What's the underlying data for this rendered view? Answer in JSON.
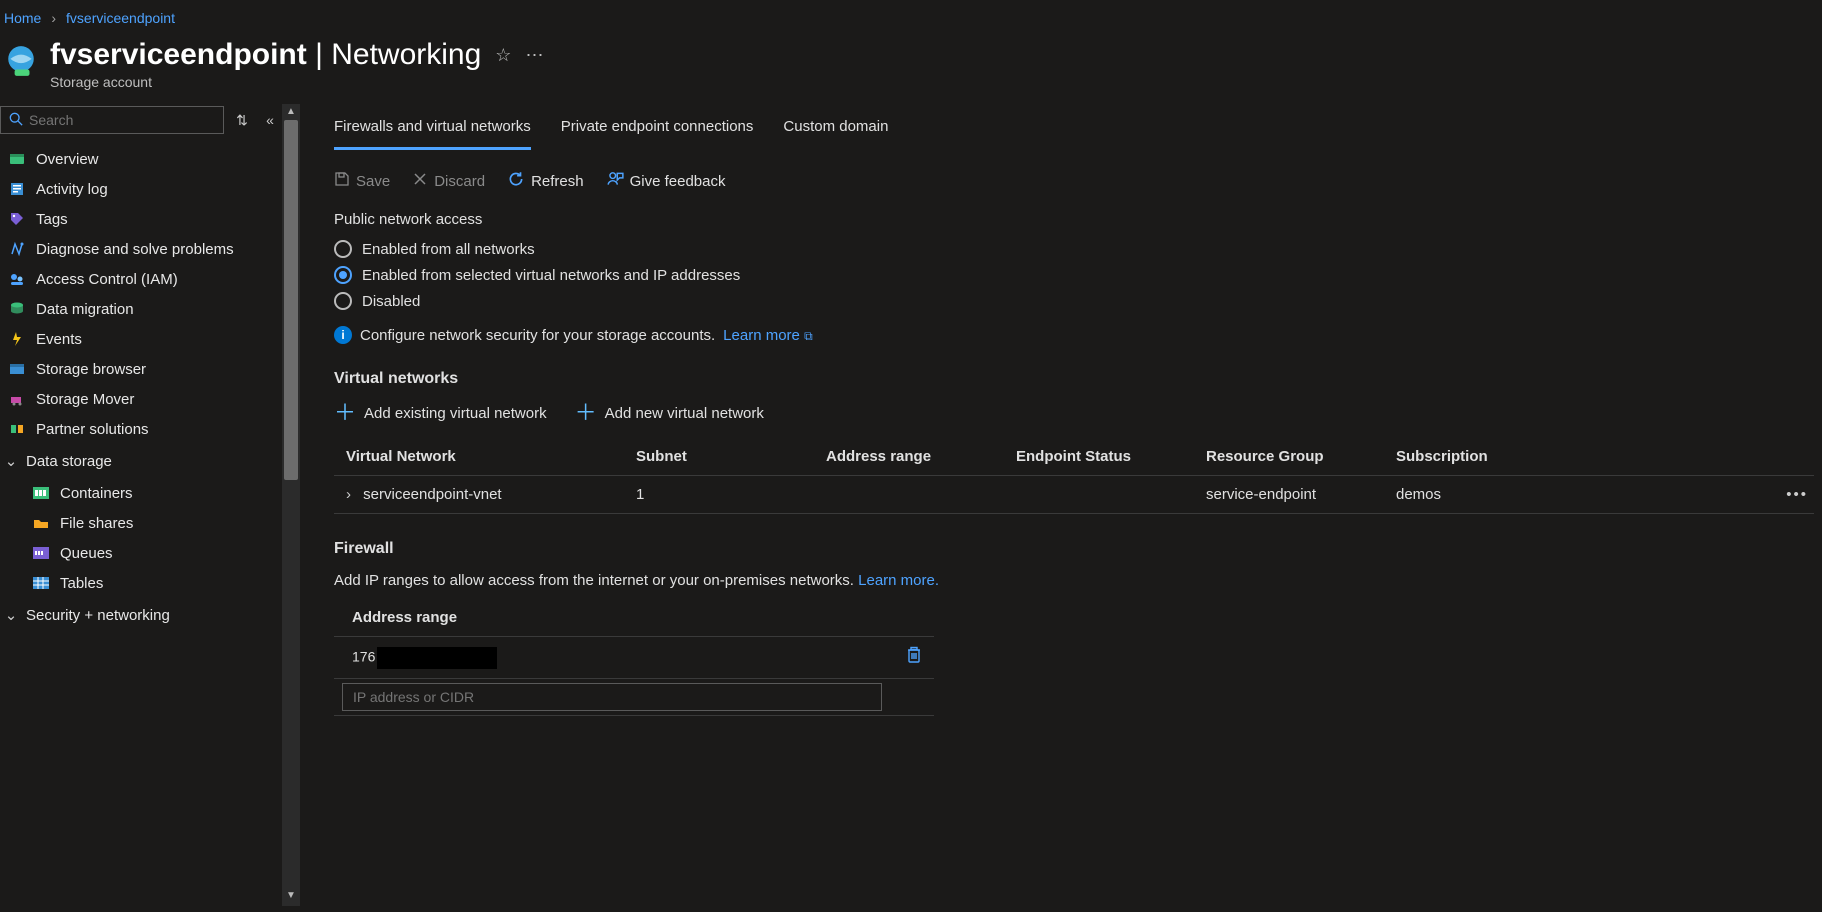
{
  "breadcrumb": {
    "home": "Home",
    "current": "fvserviceendpoint"
  },
  "header": {
    "resource": "fvserviceendpoint",
    "section": "Networking",
    "subtitle": "Storage account"
  },
  "sidebar": {
    "search_placeholder": "Search",
    "items": [
      {
        "label": "Overview"
      },
      {
        "label": "Activity log"
      },
      {
        "label": "Tags"
      },
      {
        "label": "Diagnose and solve problems"
      },
      {
        "label": "Access Control (IAM)"
      },
      {
        "label": "Data migration"
      },
      {
        "label": "Events"
      },
      {
        "label": "Storage browser"
      },
      {
        "label": "Storage Mover"
      },
      {
        "label": "Partner solutions"
      }
    ],
    "group_data_storage": "Data storage",
    "ds_items": [
      {
        "label": "Containers"
      },
      {
        "label": "File shares"
      },
      {
        "label": "Queues"
      },
      {
        "label": "Tables"
      }
    ],
    "group_security": "Security + networking"
  },
  "tabs": {
    "firewalls": "Firewalls and virtual networks",
    "private": "Private endpoint connections",
    "custom": "Custom domain"
  },
  "toolbar": {
    "save": "Save",
    "discard": "Discard",
    "refresh": "Refresh",
    "feedback": "Give feedback"
  },
  "public_access": {
    "label": "Public network access",
    "opt_all": "Enabled from all networks",
    "opt_selected": "Enabled from selected virtual networks and IP addresses",
    "opt_disabled": "Disabled"
  },
  "info": {
    "text": "Configure network security for your storage accounts.",
    "learn": "Learn more"
  },
  "vnet": {
    "heading": "Virtual networks",
    "add_existing": "Add existing virtual network",
    "add_new": "Add new virtual network",
    "cols": {
      "vn": "Virtual Network",
      "subnet": "Subnet",
      "addr": "Address range",
      "endpoint": "Endpoint Status",
      "rg": "Resource Group",
      "sub": "Subscription"
    },
    "row": {
      "name": "serviceendpoint-vnet",
      "subnet": "1",
      "addr": "",
      "endpoint": "",
      "rg": "service-endpoint",
      "sub": "demos"
    }
  },
  "firewall": {
    "heading": "Firewall",
    "desc": "Add IP ranges to allow access from the internet or your on-premises networks.",
    "learn": "Learn more.",
    "addr_col": "Address range",
    "row_prefix": "176",
    "placeholder": "IP address or CIDR"
  }
}
